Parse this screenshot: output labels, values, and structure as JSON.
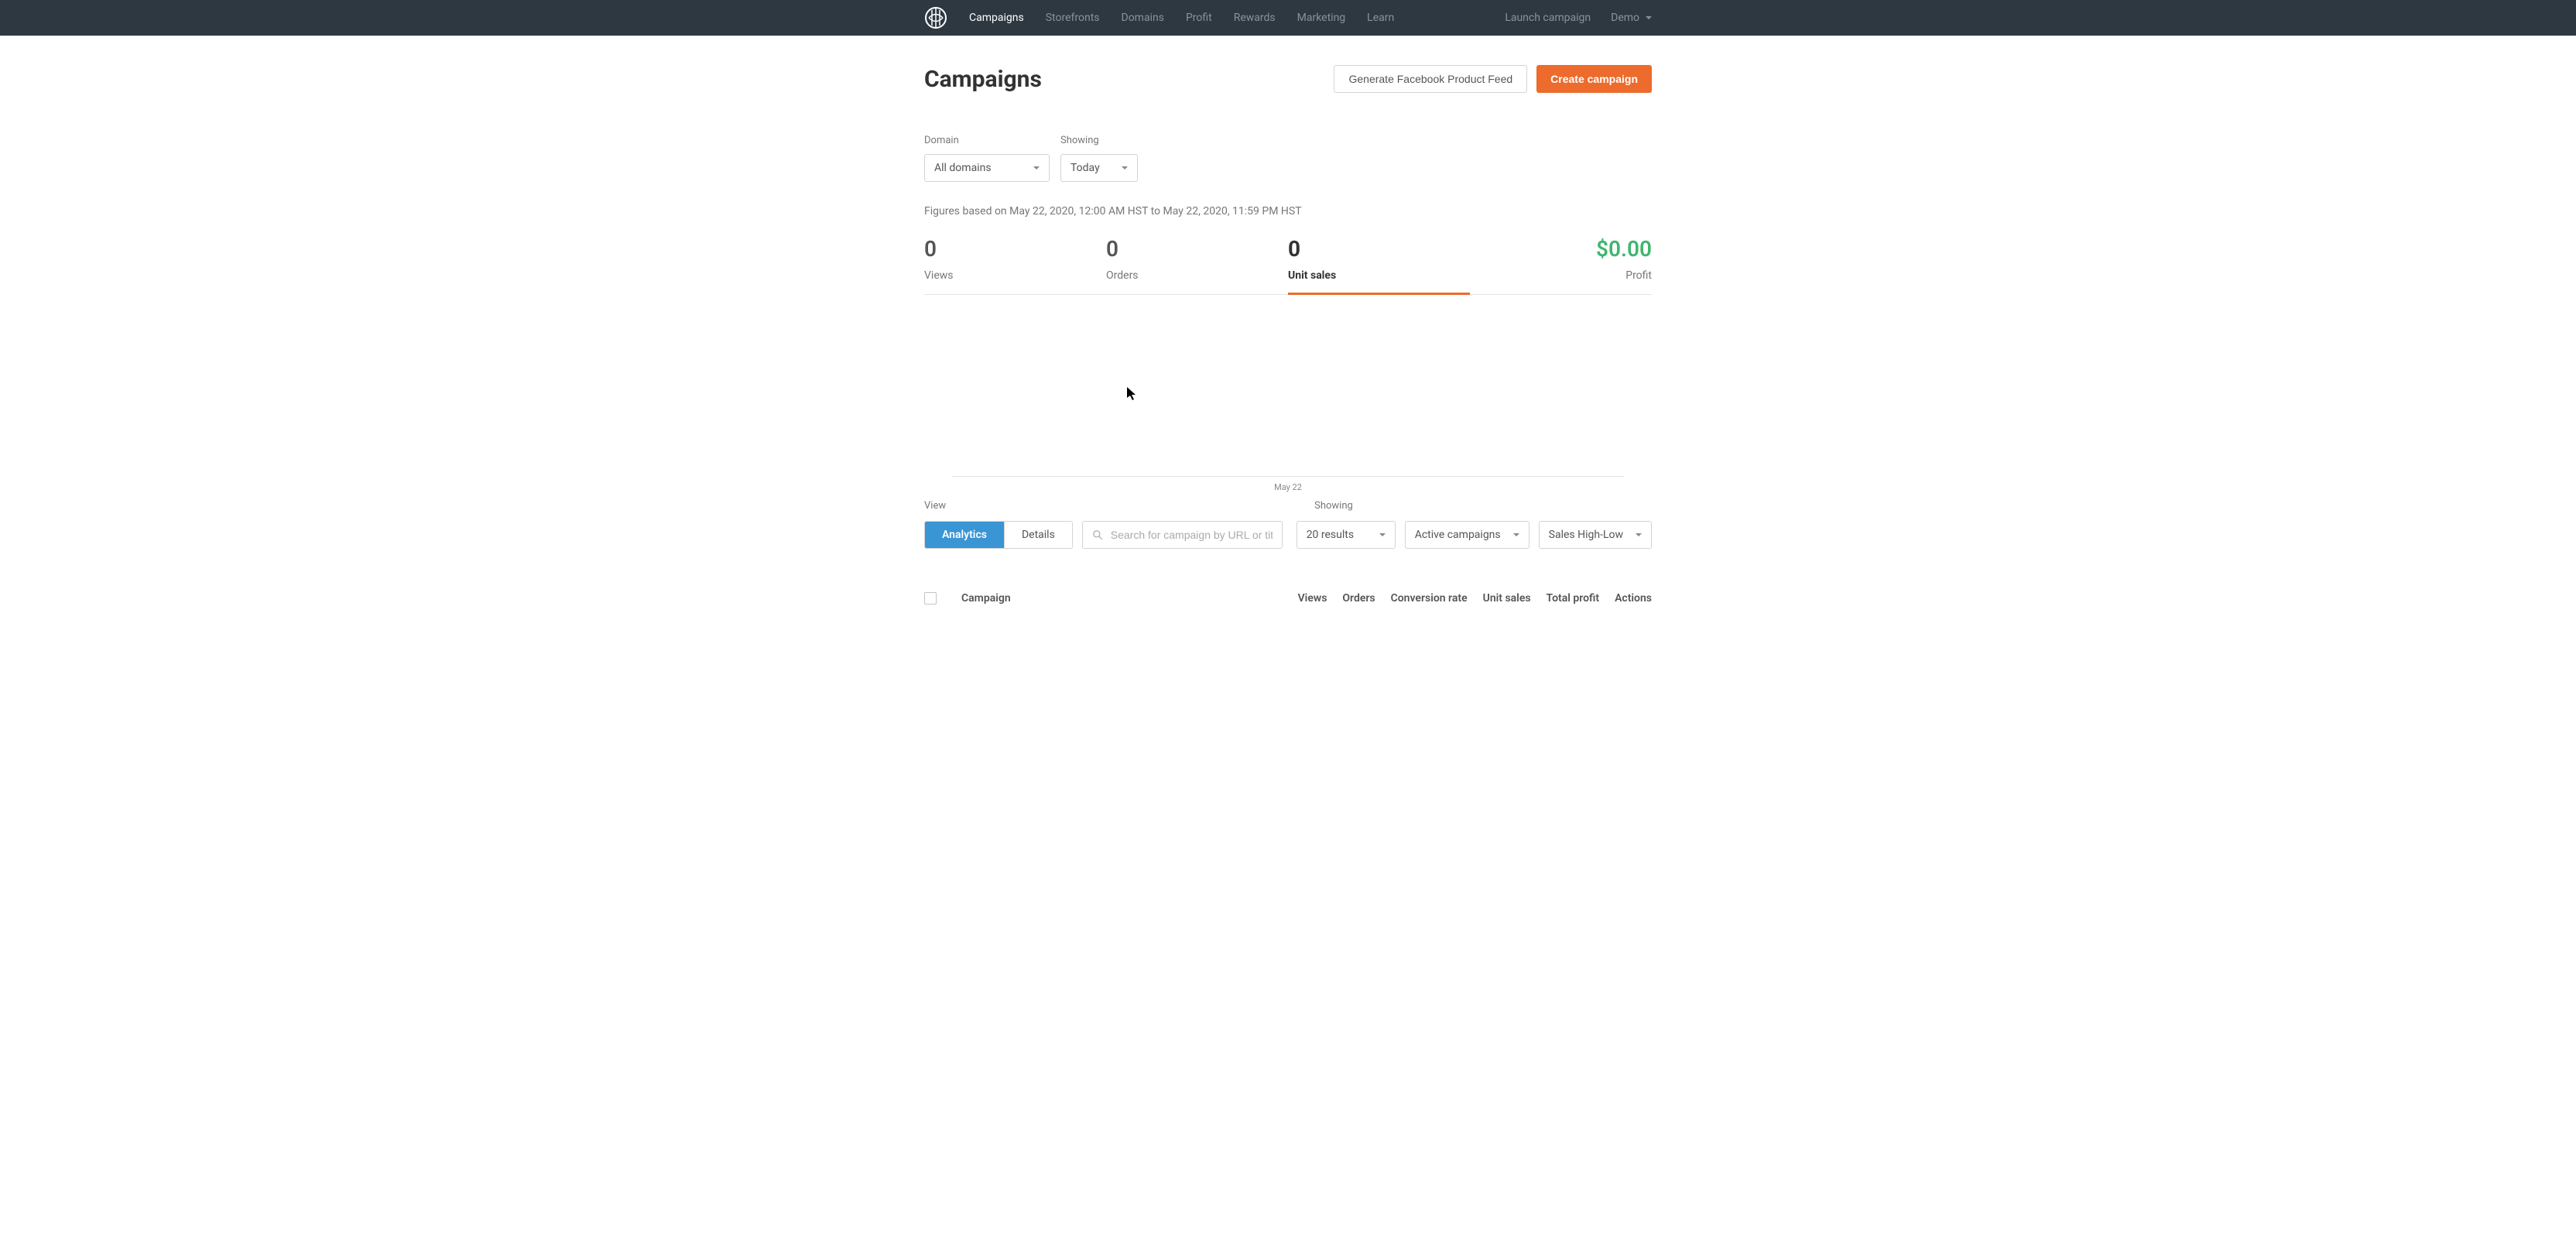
{
  "nav": {
    "links": [
      "Campaigns",
      "Storefronts",
      "Domains",
      "Profit",
      "Rewards",
      "Marketing",
      "Learn"
    ],
    "launch": "Launch campaign",
    "user": "Demo"
  },
  "page": {
    "title": "Campaigns",
    "generate_btn": "Generate Facebook Product Feed",
    "create_btn": "Create campaign"
  },
  "filters": {
    "domain_label": "Domain",
    "domain_value": "All domains",
    "showing_label": "Showing",
    "showing_value": "Today"
  },
  "figures_note": "Figures based on May 22, 2020, 12:00 AM HST to May 22, 2020, 11:59 PM HST",
  "stats": {
    "views": {
      "value": "0",
      "label": "Views"
    },
    "orders": {
      "value": "0",
      "label": "Orders"
    },
    "unit_sales": {
      "value": "0",
      "label": "Unit sales"
    },
    "profit": {
      "value": "$0.00",
      "label": "Profit"
    }
  },
  "chart_data": {
    "type": "line",
    "categories": [
      "May 22"
    ],
    "values": [
      0
    ],
    "title": "",
    "xlabel": "",
    "ylabel": "",
    "ylim": [
      0,
      1
    ]
  },
  "view_section": {
    "view_label": "View",
    "analytics": "Analytics",
    "details": "Details",
    "showing_label": "Showing",
    "search_placeholder": "Search for campaign by URL or title",
    "results": "20 results",
    "status": "Active campaigns",
    "sort": "Sales High-Low"
  },
  "table": {
    "headers": [
      "Campaign",
      "Views",
      "Orders",
      "Conversion rate",
      "Unit sales",
      "Total profit",
      "Actions"
    ]
  }
}
